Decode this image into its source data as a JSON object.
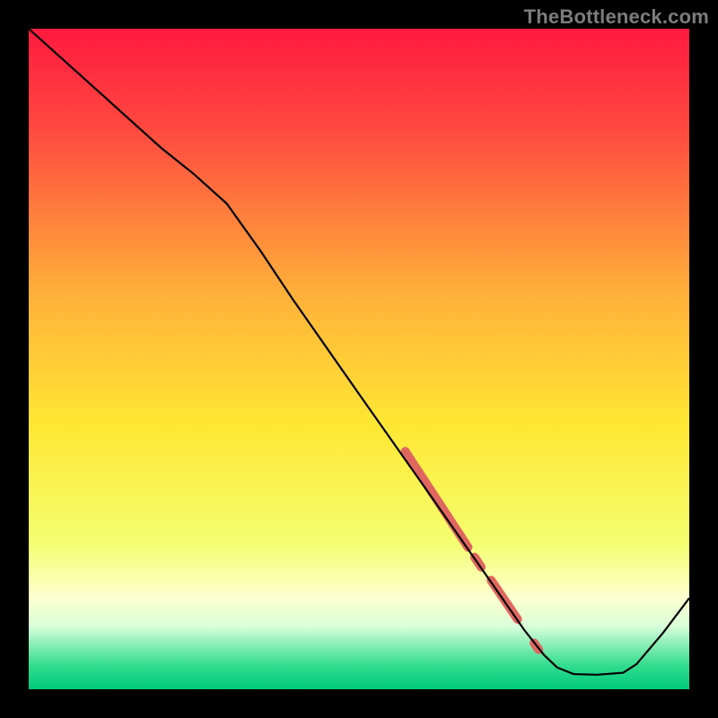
{
  "watermark": "TheBottleneck.com",
  "chart_data": {
    "type": "line",
    "title": "",
    "xlabel": "",
    "ylabel": "",
    "xlim": [
      0,
      100
    ],
    "ylim": [
      0,
      100
    ],
    "grid": false,
    "legend": false,
    "background_gradient": {
      "stops": [
        {
          "offset": 0.0,
          "color": "#ff1a3f"
        },
        {
          "offset": 0.15,
          "color": "#ff4840"
        },
        {
          "offset": 0.4,
          "color": "#ffb03a"
        },
        {
          "offset": 0.6,
          "color": "#ffe733"
        },
        {
          "offset": 0.78,
          "color": "#f4ff70"
        },
        {
          "offset": 0.86,
          "color": "#fdffce"
        },
        {
          "offset": 0.905,
          "color": "#d9ffd9"
        },
        {
          "offset": 0.93,
          "color": "#8ff0b8"
        },
        {
          "offset": 0.965,
          "color": "#2fdc8c"
        },
        {
          "offset": 1.0,
          "color": "#00c97a"
        }
      ]
    },
    "series": [
      {
        "name": "bottleneck-curve",
        "color": "#000000",
        "width": 2.2,
        "points": [
          {
            "x": 0.0,
            "y": 100.0
          },
          {
            "x": 10.0,
            "y": 91.0
          },
          {
            "x": 20.0,
            "y": 82.0
          },
          {
            "x": 25.0,
            "y": 78.0
          },
          {
            "x": 30.0,
            "y": 73.5
          },
          {
            "x": 35.0,
            "y": 66.5
          },
          {
            "x": 40.0,
            "y": 59.0
          },
          {
            "x": 50.0,
            "y": 44.7
          },
          {
            "x": 60.0,
            "y": 30.5
          },
          {
            "x": 70.0,
            "y": 16.2
          },
          {
            "x": 75.0,
            "y": 9.0
          },
          {
            "x": 78.0,
            "y": 5.2
          },
          {
            "x": 80.0,
            "y": 3.3
          },
          {
            "x": 82.5,
            "y": 2.3
          },
          {
            "x": 86.0,
            "y": 2.2
          },
          {
            "x": 90.0,
            "y": 2.5
          },
          {
            "x": 92.0,
            "y": 3.8
          },
          {
            "x": 96.0,
            "y": 8.5
          },
          {
            "x": 100.0,
            "y": 13.8
          }
        ]
      }
    ],
    "highlight_segments": {
      "color": "#e0675f",
      "segments": [
        {
          "x1": 57.0,
          "y1": 36.0,
          "x2": 66.5,
          "y2": 21.5,
          "w": 10
        },
        {
          "x1": 67.5,
          "y1": 20.0,
          "x2": 68.5,
          "y2": 18.5,
          "w": 10
        },
        {
          "x1": 70.0,
          "y1": 16.5,
          "x2": 74.0,
          "y2": 10.6,
          "w": 10
        },
        {
          "x1": 76.5,
          "y1": 7.0,
          "x2": 77.2,
          "y2": 6.0,
          "w": 10
        }
      ]
    }
  }
}
